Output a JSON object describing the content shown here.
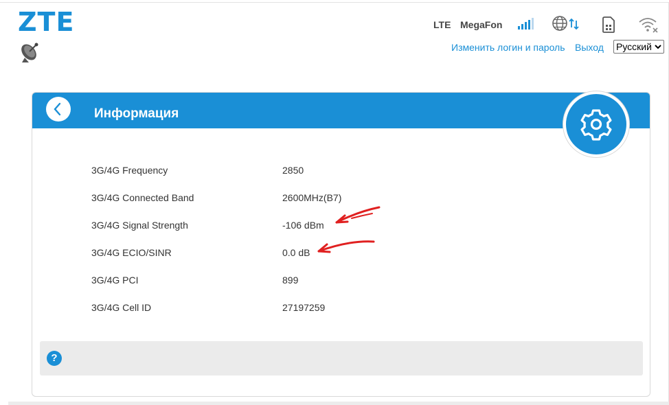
{
  "header": {
    "logo": "ZTE",
    "network_type": "LTE",
    "operator": "MegaFon",
    "links": {
      "change_login": "Изменить логин и пароль",
      "logout": "Выход"
    },
    "language": {
      "selected": "Русский"
    }
  },
  "panel": {
    "title": "Информация",
    "rows": [
      {
        "label": "3G/4G Frequency",
        "value": "2850"
      },
      {
        "label": "3G/4G Connected Band",
        "value": "2600MHz(B7)"
      },
      {
        "label": "3G/4G Signal Strength",
        "value": "-106 dBm"
      },
      {
        "label": "3G/4G ECIO/SINR",
        "value": "0.0 dB"
      },
      {
        "label": "3G/4G PCI",
        "value": "899"
      },
      {
        "label": "3G/4G Cell ID",
        "value": "27197259"
      }
    ],
    "help": "?"
  },
  "colors": {
    "accent": "#1a8fd6",
    "annotation": "#e02020"
  },
  "icons": [
    "satellite-icon",
    "signal-bars-icon",
    "globe-sync-icon",
    "sim-card-icon",
    "wifi-off-icon",
    "back-arrow-icon",
    "gear-icon",
    "help-icon"
  ]
}
